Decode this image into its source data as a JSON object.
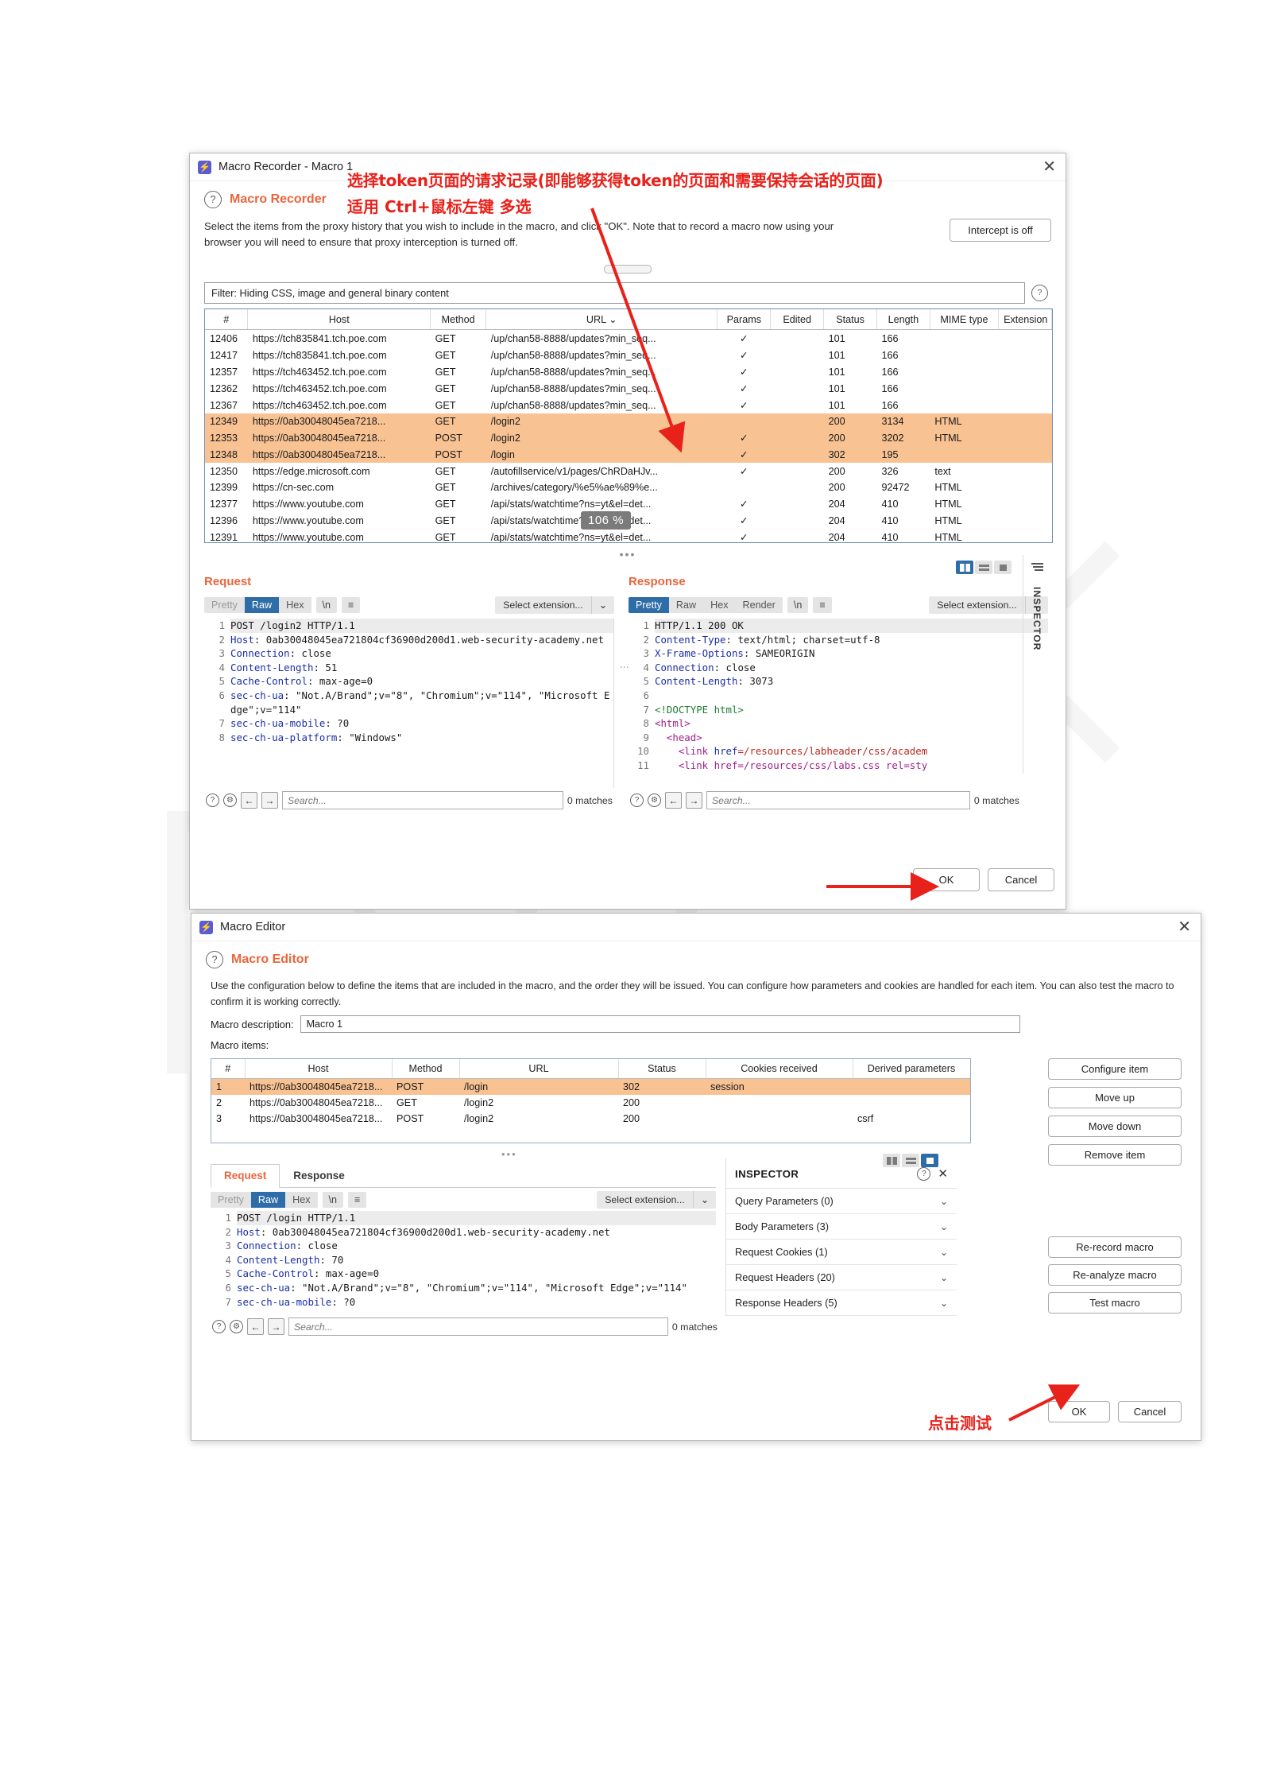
{
  "annotations": {
    "line1": "选择token页面的请求记录(即能够获得token的页面和需要保持会话的页面)",
    "line2": "适用 Ctrl+鼠标左键 多选",
    "test_hint": "点击测试",
    "zoom_badge": "106 %"
  },
  "recorder": {
    "window_title": "Macro Recorder - Macro 1",
    "section_title": "Macro Recorder",
    "blurb": "Select the items from the proxy history that you wish to include in the macro, and click \"OK\". Note that to record a macro now using your browser you will need to ensure that proxy interception is turned off.",
    "intercept_button": "Intercept is off",
    "filter_text": "Filter: Hiding CSS, image and general binary content",
    "help_icon": "question-mark-icon",
    "columns": [
      "#",
      "Host",
      "Method",
      "URL",
      "Params",
      "Edited",
      "Status",
      "Length",
      "MIME type",
      "Extension"
    ],
    "sort_column": "URL",
    "rows": [
      {
        "num": "12406",
        "host": "https://tch835841.tch.poe.com",
        "method": "GET",
        "url": "/up/chan58-8888/updates?min_seq...",
        "params": "✓",
        "edited": "",
        "status": "101",
        "length": "166",
        "mime": "",
        "ext": "",
        "selected": false
      },
      {
        "num": "12417",
        "host": "https://tch835841.tch.poe.com",
        "method": "GET",
        "url": "/up/chan58-8888/updates?min_seq...",
        "params": "✓",
        "edited": "",
        "status": "101",
        "length": "166",
        "mime": "",
        "ext": "",
        "selected": false
      },
      {
        "num": "12357",
        "host": "https://tch463452.tch.poe.com",
        "method": "GET",
        "url": "/up/chan58-8888/updates?min_seq...",
        "params": "✓",
        "edited": "",
        "status": "101",
        "length": "166",
        "mime": "",
        "ext": "",
        "selected": false
      },
      {
        "num": "12362",
        "host": "https://tch463452.tch.poe.com",
        "method": "GET",
        "url": "/up/chan58-8888/updates?min_seq...",
        "params": "✓",
        "edited": "",
        "status": "101",
        "length": "166",
        "mime": "",
        "ext": "",
        "selected": false
      },
      {
        "num": "12367",
        "host": "https://tch463452.tch.poe.com",
        "method": "GET",
        "url": "/up/chan58-8888/updates?min_seq...",
        "params": "✓",
        "edited": "",
        "status": "101",
        "length": "166",
        "mime": "",
        "ext": "",
        "selected": false
      },
      {
        "num": "12349",
        "host": "https://0ab30048045ea7218...",
        "method": "GET",
        "url": "/login2",
        "params": "",
        "edited": "",
        "status": "200",
        "length": "3134",
        "mime": "HTML",
        "ext": "",
        "selected": true
      },
      {
        "num": "12353",
        "host": "https://0ab30048045ea7218...",
        "method": "POST",
        "url": "/login2",
        "params": "✓",
        "edited": "",
        "status": "200",
        "length": "3202",
        "mime": "HTML",
        "ext": "",
        "selected": true
      },
      {
        "num": "12348",
        "host": "https://0ab30048045ea7218...",
        "method": "POST",
        "url": "/login",
        "params": "✓",
        "edited": "",
        "status": "302",
        "length": "195",
        "mime": "",
        "ext": "",
        "selected": true
      },
      {
        "num": "12350",
        "host": "https://edge.microsoft.com",
        "method": "GET",
        "url": "/autofillservice/v1/pages/ChRDaHJv...",
        "params": "✓",
        "edited": "",
        "status": "200",
        "length": "326",
        "mime": "text",
        "ext": "",
        "selected": false
      },
      {
        "num": "12399",
        "host": "https://cn-sec.com",
        "method": "GET",
        "url": "/archives/category/%e5%ae%89%e...",
        "params": "",
        "edited": "",
        "status": "200",
        "length": "92472",
        "mime": "HTML",
        "ext": "",
        "selected": false
      },
      {
        "num": "12377",
        "host": "https://www.youtube.com",
        "method": "GET",
        "url": "/api/stats/watchtime?ns=yt&el=det...",
        "params": "✓",
        "edited": "",
        "status": "204",
        "length": "410",
        "mime": "HTML",
        "ext": "",
        "selected": false
      },
      {
        "num": "12396",
        "host": "https://www.youtube.com",
        "method": "GET",
        "url": "/api/stats/watchtime?ns=yt&el=det...",
        "params": "✓",
        "edited": "",
        "status": "204",
        "length": "410",
        "mime": "HTML",
        "ext": "",
        "selected": false
      },
      {
        "num": "12391",
        "host": "https://www.youtube.com",
        "method": "GET",
        "url": "/api/stats/watchtime?ns=yt&el=det...",
        "params": "✓",
        "edited": "",
        "status": "204",
        "length": "410",
        "mime": "HTML",
        "ext": "",
        "selected": false
      }
    ],
    "request": {
      "title": "Request",
      "modes": [
        "Pretty",
        "Raw",
        "Hex"
      ],
      "active_mode": "Raw",
      "newline_label": "\\n",
      "menu_label": "≡",
      "select_extension": "Select extension...",
      "lines": [
        {
          "n": "1",
          "segments": [
            {
              "t": "POST /login2 HTTP/1.1",
              "c": "first"
            }
          ]
        },
        {
          "n": "2",
          "segments": [
            {
              "t": "Host",
              "c": "hdr"
            },
            {
              "t": ": 0ab30048045ea721804cf36900d200d1.web-security-academy.net",
              "c": ""
            }
          ]
        },
        {
          "n": "3",
          "segments": [
            {
              "t": "Connection",
              "c": "hdr"
            },
            {
              "t": ": close",
              "c": ""
            }
          ]
        },
        {
          "n": "4",
          "segments": [
            {
              "t": "Content-Length",
              "c": "hdr"
            },
            {
              "t": ": 51",
              "c": ""
            }
          ]
        },
        {
          "n": "5",
          "segments": [
            {
              "t": "Cache-Control",
              "c": "hdr"
            },
            {
              "t": ": max-age=0",
              "c": ""
            }
          ]
        },
        {
          "n": "6",
          "segments": [
            {
              "t": "sec-ch-ua",
              "c": "hdr"
            },
            {
              "t": ": \"Not.A/Brand\";v=\"8\", \"Chromium\";v=\"114\", \"Microsoft Edge\";v=\"114\"",
              "c": ""
            }
          ]
        },
        {
          "n": "7",
          "segments": [
            {
              "t": "sec-ch-ua-mobile",
              "c": "hdr"
            },
            {
              "t": ": ?0",
              "c": ""
            }
          ]
        },
        {
          "n": "8",
          "segments": [
            {
              "t": "sec-ch-ua-platform",
              "c": "hdr"
            },
            {
              "t": ": \"Windows\"",
              "c": ""
            }
          ]
        }
      ],
      "search_placeholder": "Search...",
      "matches": "0 matches"
    },
    "response": {
      "title": "Response",
      "modes": [
        "Pretty",
        "Raw",
        "Hex",
        "Render"
      ],
      "active_mode": "Pretty",
      "newline_label": "\\n",
      "menu_label": "≡",
      "select_extension": "Select extension...",
      "lines": [
        {
          "n": "1",
          "segments": [
            {
              "t": "HTTP/1.1 200 OK",
              "c": "first"
            }
          ]
        },
        {
          "n": "2",
          "segments": [
            {
              "t": "Content-Type",
              "c": "hdr"
            },
            {
              "t": ": text/html; charset=utf-8",
              "c": ""
            }
          ]
        },
        {
          "n": "3",
          "segments": [
            {
              "t": "X-Frame-Options",
              "c": "hdr"
            },
            {
              "t": ": SAMEORIGIN",
              "c": ""
            }
          ]
        },
        {
          "n": "4",
          "segments": [
            {
              "t": "Connection",
              "c": "hdr"
            },
            {
              "t": ": close",
              "c": ""
            }
          ]
        },
        {
          "n": "5",
          "segments": [
            {
              "t": "Content-Length",
              "c": "hdr"
            },
            {
              "t": ": 3073",
              "c": ""
            }
          ]
        },
        {
          "n": "6",
          "segments": [
            {
              "t": " ",
              "c": ""
            }
          ]
        },
        {
          "n": "7",
          "segments": [
            {
              "t": "<!DOCTYPE html>",
              "c": "doct"
            }
          ]
        },
        {
          "n": "8",
          "segments": [
            {
              "t": "<html>",
              "c": "tag"
            }
          ]
        },
        {
          "n": "9",
          "segments": [
            {
              "t": "  <head>",
              "c": "tag"
            }
          ]
        },
        {
          "n": "10",
          "segments": [
            {
              "t": "    <link ",
              "c": "tag"
            },
            {
              "t": "href",
              "c": "attr"
            },
            {
              "t": "=/resources/labheader/css/academ",
              "c": "val"
            }
          ]
        },
        {
          "n": "11",
          "segments": [
            {
              "t": "    <link href=/resources/css/labs.css rel=sty",
              "c": "tag"
            }
          ]
        }
      ],
      "search_placeholder": "Search...",
      "matches": "0 matches"
    },
    "inspector_rail_label": "INSPECTOR",
    "ok_button": "OK",
    "cancel_button": "Cancel"
  },
  "editor": {
    "window_title": "Macro Editor",
    "section_title": "Macro Editor",
    "blurb": "Use the configuration below to define the items that are included in the macro, and the order they will be issued. You can configure how parameters and cookies are handled for each item. You can also test the macro to confirm it is working correctly.",
    "description_label": "Macro description:",
    "description_value": "Macro 1",
    "items_label": "Macro items:",
    "columns": [
      "#",
      "Host",
      "Method",
      "URL",
      "Status",
      "Cookies received",
      "Derived parameters"
    ],
    "rows": [
      {
        "num": "1",
        "host": "https://0ab30048045ea7218...",
        "method": "POST",
        "url": "/login",
        "status": "302",
        "cookies": "session",
        "derived": "",
        "selected": true
      },
      {
        "num": "2",
        "host": "https://0ab30048045ea7218...",
        "method": "GET",
        "url": "/login2",
        "status": "200",
        "cookies": "",
        "derived": "",
        "selected": false
      },
      {
        "num": "3",
        "host": "https://0ab30048045ea7218...",
        "method": "POST",
        "url": "/login2",
        "status": "200",
        "cookies": "",
        "derived": "csrf",
        "selected": false
      }
    ],
    "side_buttons": [
      "Configure item",
      "Move up",
      "Move down",
      "Remove item"
    ],
    "macro_buttons": [
      "Re-record macro",
      "Re-analyze macro",
      "Test macro"
    ],
    "tabs": [
      "Request",
      "Response"
    ],
    "active_tab": "Request",
    "request": {
      "modes": [
        "Pretty",
        "Raw",
        "Hex"
      ],
      "active_mode": "Raw",
      "newline_label": "\\n",
      "menu_label": "≡",
      "select_extension": "Select extension...",
      "lines": [
        {
          "n": "1",
          "segments": [
            {
              "t": "POST /login HTTP/1.1",
              "c": "first"
            }
          ]
        },
        {
          "n": "2",
          "segments": [
            {
              "t": "Host",
              "c": "hdr"
            },
            {
              "t": ": 0ab30048045ea721804cf36900d200d1.web-security-academy.net",
              "c": ""
            }
          ]
        },
        {
          "n": "3",
          "segments": [
            {
              "t": "Connection",
              "c": "hdr"
            },
            {
              "t": ": close",
              "c": ""
            }
          ]
        },
        {
          "n": "4",
          "segments": [
            {
              "t": "Content-Length",
              "c": "hdr"
            },
            {
              "t": ": 70",
              "c": ""
            }
          ]
        },
        {
          "n": "5",
          "segments": [
            {
              "t": "Cache-Control",
              "c": "hdr"
            },
            {
              "t": ": max-age=0",
              "c": ""
            }
          ]
        },
        {
          "n": "6",
          "segments": [
            {
              "t": "sec-ch-ua",
              "c": "hdr"
            },
            {
              "t": ": \"Not.A/Brand\";v=\"8\", \"Chromium\";v=\"114\", \"Microsoft Edge\";v=\"114\"",
              "c": ""
            }
          ]
        },
        {
          "n": "7",
          "segments": [
            {
              "t": "sec-ch-ua-mobile",
              "c": "hdr"
            },
            {
              "t": ": ?0",
              "c": ""
            }
          ]
        }
      ],
      "search_placeholder": "Search...",
      "matches": "0 matches"
    },
    "inspector": {
      "title": "INSPECTOR",
      "rows": [
        "Query Parameters (0)",
        "Body Parameters (3)",
        "Request Cookies (1)",
        "Request Headers (20)",
        "Response Headers (5)"
      ]
    },
    "ok_button": "OK",
    "cancel_button": "Cancel"
  },
  "colors": {
    "accent_orange": "#e8663d",
    "selection": "#f8c293",
    "blue_active": "#2f6da8",
    "annotation_red": "#e8211a"
  }
}
